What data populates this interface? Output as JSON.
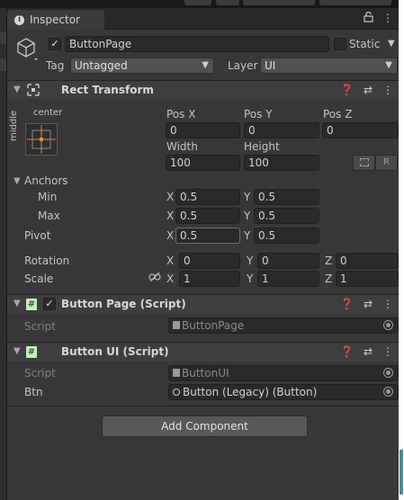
{
  "window": {
    "tab_label": "Inspector",
    "tab_icon": "info-icon"
  },
  "object": {
    "name": "ButtonPage",
    "active": true,
    "static_label": "Static",
    "tag_label": "Tag",
    "tag_value": "Untagged",
    "layer_label": "Layer",
    "layer_value": "UI"
  },
  "rect_transform": {
    "title": "Rect Transform",
    "anchor_preset_h": "center",
    "anchor_preset_v": "middle",
    "pos_x_label": "Pos X",
    "pos_x": "0",
    "pos_y_label": "Pos Y",
    "pos_y": "0",
    "pos_z_label": "Pos Z",
    "pos_z": "0",
    "width_label": "Width",
    "width": "100",
    "height_label": "Height",
    "height": "100",
    "raw_button": "R",
    "anchors_label": "Anchors",
    "min_label": "Min",
    "min_x": "0.5",
    "min_y": "0.5",
    "max_label": "Max",
    "max_x": "0.5",
    "max_y": "0.5",
    "pivot_label": "Pivot",
    "pivot_x": "0.5",
    "pivot_y": "0.5",
    "rotation_label": "Rotation",
    "rot_x": "0",
    "rot_y": "0",
    "rot_z": "0",
    "scale_label": "Scale",
    "scale_x": "1",
    "scale_y": "1",
    "scale_z": "1",
    "x": "X",
    "y": "Y",
    "z": "Z"
  },
  "button_page_script": {
    "title": "Button Page (Script)",
    "enabled": true,
    "script_label": "Script",
    "script_value": "ButtonPage"
  },
  "button_ui_script": {
    "title": "Button UI (Script)",
    "script_label": "Script",
    "script_value": "ButtonUI",
    "btn_label": "Btn",
    "btn_value": "Button (Legacy) (Button)"
  },
  "add_component_label": "Add Component",
  "colors": {
    "panel_bg": "#383838",
    "field_bg": "#2a2a2a",
    "header_bg": "#3e3e3e",
    "anchor_accent": "#e0902a"
  }
}
